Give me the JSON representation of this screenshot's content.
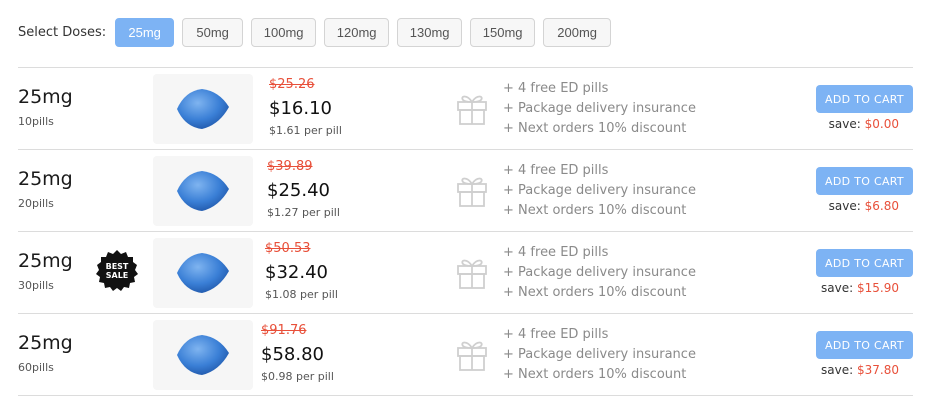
{
  "doses": {
    "label": "Select Doses:",
    "options": [
      "25mg",
      "50mg",
      "100mg",
      "120mg",
      "130mg",
      "150mg",
      "200mg"
    ],
    "selected": "25mg"
  },
  "packages": [
    {
      "dose": "25mg",
      "pills": "10pills",
      "old_price": "$25.26",
      "price": "$16.10",
      "per_pill": "$1.61 per pill",
      "perks": [
        "+ 4 free ED pills",
        "+ Package delivery insurance",
        "+ Next orders 10% discount"
      ],
      "cart_label": "ADD TO CART",
      "save_label": "save:",
      "save_amount": "$0.00",
      "best_sale": false
    },
    {
      "dose": "25mg",
      "pills": "20pills",
      "old_price": "$39.89",
      "price": "$25.40",
      "per_pill": "$1.27 per pill",
      "perks": [
        "+ 4 free ED pills",
        "+ Package delivery insurance",
        "+ Next orders 10% discount"
      ],
      "cart_label": "ADD TO CART",
      "save_label": "save:",
      "save_amount": "$6.80",
      "best_sale": false
    },
    {
      "dose": "25mg",
      "pills": "30pills",
      "old_price": "$50.53",
      "price": "$32.40",
      "per_pill": "$1.08 per pill",
      "perks": [
        "+ 4 free ED pills",
        "+ Package delivery insurance",
        "+ Next orders 10% discount"
      ],
      "cart_label": "ADD TO CART",
      "save_label": "save:",
      "save_amount": "$15.90",
      "best_sale": true,
      "badge_text": [
        "BEST",
        "SALE"
      ]
    },
    {
      "dose": "25mg",
      "pills": "60pills",
      "old_price": "$91.76",
      "price": "$58.80",
      "per_pill": "$0.98 per pill",
      "perks": [
        "+ 4 free ED pills",
        "+ Package delivery insurance",
        "+ Next orders 10% discount"
      ],
      "cart_label": "ADD TO CART",
      "save_label": "save:",
      "save_amount": "$37.80",
      "best_sale": false
    }
  ],
  "colors": {
    "accent": "#7db3f4",
    "strike_price": "#e8503a",
    "save_amount": "#e8503a",
    "pill": "#3a7fd6"
  },
  "icons": {
    "pill": "blue-diamond-pill-icon",
    "gift": "gift-box-icon",
    "badge": "best-sale-seal-icon"
  }
}
